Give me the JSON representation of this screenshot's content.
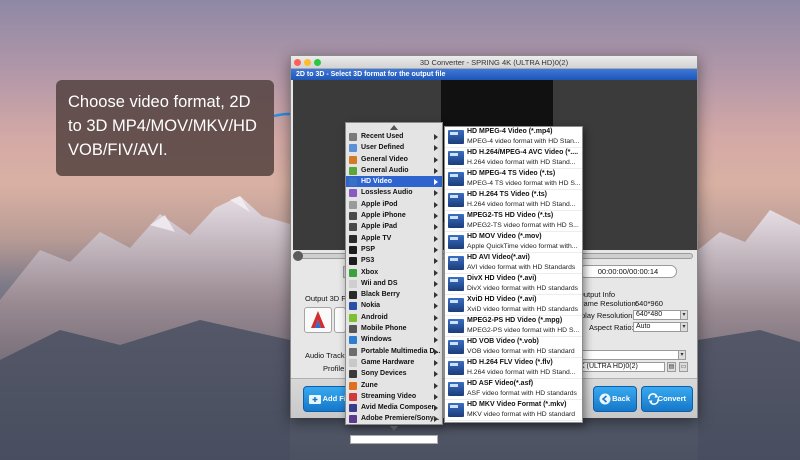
{
  "callout": {
    "lines": [
      "Choose video format,  2D",
      "to 3D MP4/MOV/MKV/HD",
      "VOB/FIV/AVI."
    ]
  },
  "window": {
    "title": "3D Converter - SPRING 4K (ULTRA HD)0(2)",
    "subtitle": "2D to 3D - Select 3D format for the output file",
    "time": "00:00:00/00:00:14",
    "output_3d_label": "Output 3D Fo",
    "output_info_label": "Output Info",
    "frame_resolution_label": "rame Resolution:",
    "frame_resolution_value": "640*960",
    "display_resolution_label": "play Resolution:",
    "display_resolution_value": "640*480",
    "aspect_ratio_label": "Aspect Ratio:",
    "aspect_ratio_value": "Auto",
    "audio_track_label": "Audio Track",
    "profile_label": "Profile",
    "profile_value": "K (ULTRA HD)0(2)",
    "add_file_label": "Add Fil",
    "back_label": "Back",
    "convert_label": "Convert"
  },
  "categories": [
    {
      "label": "Recent Used",
      "icon_color": "#7a7a7a"
    },
    {
      "label": "User Defined",
      "icon_color": "#5b8fd6"
    },
    {
      "label": "General Video",
      "icon_color": "#d07a2a"
    },
    {
      "label": "General Audio",
      "icon_color": "#5aa63c"
    },
    {
      "label": "HD Video",
      "icon_color": "#3a6fc2",
      "active": true
    },
    {
      "label": "Lossless Audio",
      "icon_color": "#8a5ac4"
    },
    {
      "label": "Apple iPod",
      "icon_color": "#9a9a9a"
    },
    {
      "label": "Apple iPhone",
      "icon_color": "#4a4a4a"
    },
    {
      "label": "Apple iPad",
      "icon_color": "#4a4a4a"
    },
    {
      "label": "Apple TV",
      "icon_color": "#2a2a2a"
    },
    {
      "label": "PSP",
      "icon_color": "#1c1c1c"
    },
    {
      "label": "PS3",
      "icon_color": "#1c1c1c"
    },
    {
      "label": "Xbox",
      "icon_color": "#3aa23a"
    },
    {
      "label": "Wii and DS",
      "icon_color": "#cfcfcf"
    },
    {
      "label": "Black Berry",
      "icon_color": "#2a2a2a"
    },
    {
      "label": "Nokia",
      "icon_color": "#2a4fa8"
    },
    {
      "label": "Android",
      "icon_color": "#7cbf2f"
    },
    {
      "label": "Mobile Phone",
      "icon_color": "#555555"
    },
    {
      "label": "Windows",
      "icon_color": "#2d7dd2"
    },
    {
      "label": "Portable Multimedia D...",
      "icon_color": "#6d6d6d"
    },
    {
      "label": "Game Hardware",
      "icon_color": "#c8c8c8"
    },
    {
      "label": "Sony Devices",
      "icon_color": "#3a3a3a"
    },
    {
      "label": "Zune",
      "icon_color": "#e07020"
    },
    {
      "label": "Streaming Video",
      "icon_color": "#d23b3b"
    },
    {
      "label": "Avid Media Composer",
      "icon_color": "#3c3c8c"
    },
    {
      "label": "Adobe Premiere/Sony...",
      "icon_color": "#5a3a8c"
    }
  ],
  "formats": [
    {
      "name": "HD MPEG-4 Video (*.mp4)",
      "desc": "MPEG-4 video format with HD Stan..."
    },
    {
      "name": "HD H.264/MPEG-4 AVC Video (*....",
      "desc": "H.264 video format with HD Stand..."
    },
    {
      "name": "HD MPEG-4 TS Video (*.ts)",
      "desc": "MPEG-4 TS video format with HD S..."
    },
    {
      "name": "HD H.264 TS Video (*.ts)",
      "desc": "H.264 video format with HD Stand..."
    },
    {
      "name": "MPEG2-TS HD Video (*.ts)",
      "desc": "MPEG2-TS video format with HD S..."
    },
    {
      "name": "HD MOV Video (*.mov)",
      "desc": "Apple QuickTime video format with..."
    },
    {
      "name": "HD AVI Video(*.avi)",
      "desc": "AVI video format with HD Standards"
    },
    {
      "name": "DivX HD Video (*.avi)",
      "desc": "DivX video format with HD standards"
    },
    {
      "name": "XviD HD Video (*.avi)",
      "desc": "XviD video format with HD standards"
    },
    {
      "name": "MPEG2-PS HD Video (*.mpg)",
      "desc": "MPEG2-PS video format with HD S..."
    },
    {
      "name": "HD VOB Video (*.vob)",
      "desc": "VOB video format with HD standard"
    },
    {
      "name": "HD H.264 FLV Video (*.flv)",
      "desc": "H.264 video format with HD Stand..."
    },
    {
      "name": "HD ASF Video(*.asf)",
      "desc": "ASF video format with HD standards"
    },
    {
      "name": "HD MKV Video Format (*.mkv)",
      "desc": "MKV video format with HD standard"
    }
  ],
  "colors": {
    "accent": "#2f64cf",
    "title_bar": "#3d78d8",
    "button": "#1677c9"
  }
}
